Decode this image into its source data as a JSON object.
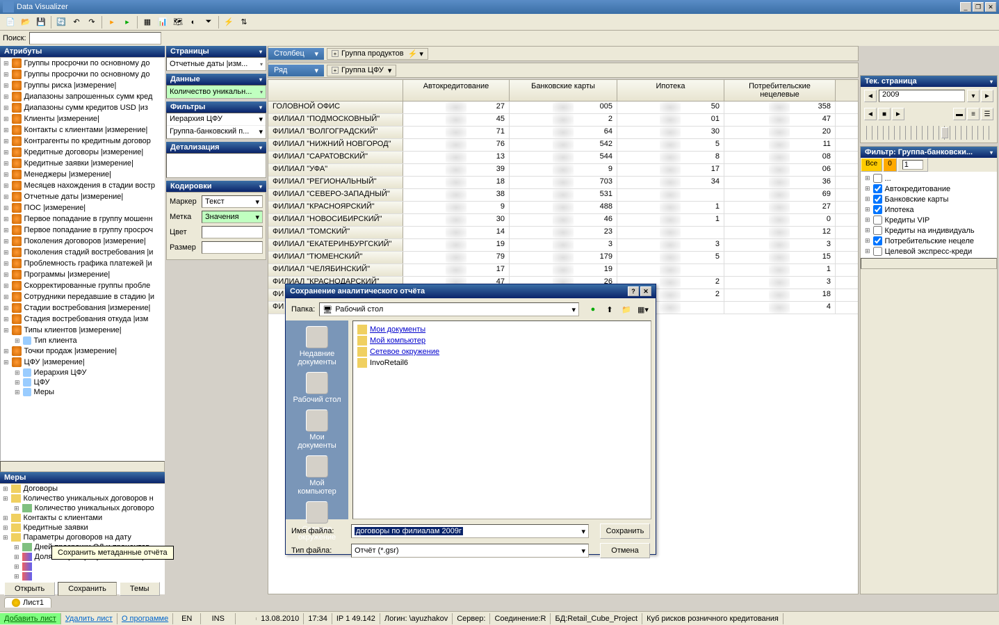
{
  "app": {
    "title": "Data Visualizer"
  },
  "search": {
    "label": "Поиск:",
    "value": ""
  },
  "attributes": {
    "header": "Атрибуты",
    "items": [
      "Группы просрочки по основному до",
      "Группы просрочки по основному до",
      "Группы риска  |измерение|",
      "Диапазоны запрошенных сумм кред",
      "Диапазоны сумм кредитов USD  |из",
      "Клиенты  |измерение|",
      "Контакты с клиентами  |измерение|",
      "Контрагенты по кредитным договор",
      "Кредитные договоры  |измерение|",
      "Кредитные заявки  |измерение|",
      "Менеджеры  |измерение|",
      "Месяцев нахождения в стадии востр",
      "Отчетные даты  |измерение|",
      "ПОС  |измерение|",
      "Первое попадание в группу мошенн",
      "Первое попадание в группу просроч",
      "Поколения договоров  |измерение|",
      "Поколения стадий востребования  |и",
      "Проблемность графика платежей  |и",
      "Программы  |измерение|",
      "Скорректированные группы пробле",
      "Сотрудники передавшие в стадию  |и",
      "Стадии востребования  |измерение|",
      "Стадия востребования откуда  |изм"
    ],
    "expanded1": {
      "label": "Типы клиентов  |измерение|",
      "child": "Тип клиента"
    },
    "item2": "Точки продаж  |измерение|",
    "expanded2": {
      "label": "ЦФУ  |измерение|",
      "children": [
        "Иерархия ЦФУ",
        "ЦФУ",
        "Меры"
      ]
    }
  },
  "measures": {
    "header": "Меры",
    "items": [
      {
        "t": "folder",
        "label": "Договоры"
      },
      {
        "t": "folder-open",
        "label": "Количество уникальных договоров н",
        "child": "Количество уникальных договоро"
      },
      {
        "t": "folder",
        "label": "Контакты с клиентами"
      },
      {
        "t": "folder",
        "label": "Кредитные заявки"
      },
      {
        "t": "folder-open",
        "label": "Параметры договоров на дату",
        "children": [
          {
            "t": "m",
            "label": "Дней просрочки ОД и процентов"
          },
          {
            "t": "p",
            "label": "Доля общей просрочки от общег"
          },
          {
            "t": "p",
            "label": ""
          },
          {
            "t": "p",
            "label": ""
          }
        ]
      }
    ]
  },
  "mid": {
    "pages": {
      "header": "Страницы",
      "value": "Отчетные даты  |изм..."
    },
    "data": {
      "header": "Данные",
      "value": "Количество  уникальн..."
    },
    "filters": {
      "header": "Фильтры",
      "items": [
        "Иерархия ЦФУ",
        "Группа-банковский  п..."
      ]
    },
    "detail": {
      "header": "Детализация",
      "value": ""
    },
    "encoding": {
      "header": "Кодировки",
      "marker_label": "Маркер",
      "marker_value": "Текст",
      "label_label": "Метка",
      "label_value": "Значения",
      "color_label": "Цвет",
      "color_value": "",
      "size_label": "Размер",
      "size_value": ""
    }
  },
  "grid": {
    "col_label": "Столбец",
    "col_value": "Группа продуктов",
    "row_label": "Ряд",
    "row_value": "Группа ЦФУ",
    "cols": [
      "",
      "Автокредитование",
      "Банковские карты",
      "Ипотека",
      "Потребительские нецелевые"
    ],
    "rows": [
      {
        "h": "ГОЛОВНОЙ ОФИС",
        "v": [
          "27",
          "005",
          "50",
          "358"
        ]
      },
      {
        "h": "ФИЛИАЛ \"ПОДМОСКОВНЫЙ\"",
        "v": [
          "45",
          "2",
          "01",
          "47"
        ]
      },
      {
        "h": "ФИЛИАЛ \"ВОЛГОГРАДСКИЙ\"",
        "v": [
          "71",
          "64",
          "30",
          "20"
        ]
      },
      {
        "h": "ФИЛИАЛ \"НИЖНИЙ НОВГОРОД\"",
        "v": [
          "76",
          "542",
          "5",
          "11"
        ]
      },
      {
        "h": "ФИЛИАЛ \"САРАТОВСКИЙ\"",
        "v": [
          "13",
          "544",
          "8",
          "08"
        ]
      },
      {
        "h": "ФИЛИАЛ \"УФА\"",
        "v": [
          "39",
          "9",
          "17",
          "06"
        ]
      },
      {
        "h": "ФИЛИАЛ \"РЕГИОНАЛЬНЫЙ\"",
        "v": [
          "18",
          "703",
          "34",
          "36"
        ]
      },
      {
        "h": "ФИЛИАЛ \"СЕВЕРО-ЗАПАДНЫЙ\"",
        "v": [
          "38",
          "531",
          "",
          "69"
        ]
      },
      {
        "h": "ФИЛИАЛ \"КРАСНОЯРСКИЙ\"",
        "v": [
          "9",
          "488",
          "1",
          "27"
        ]
      },
      {
        "h": "ФИЛИАЛ \"НОВОСИБИРСКИЙ\"",
        "v": [
          "30",
          "46",
          "1",
          "0"
        ]
      },
      {
        "h": "ФИЛИАЛ \"ТОМСКИЙ\"",
        "v": [
          "14",
          "23",
          "",
          "12"
        ]
      },
      {
        "h": "ФИЛИАЛ \"ЕКАТЕРИНБУРГСКИЙ\"",
        "v": [
          "19",
          "3",
          "3",
          "3"
        ]
      },
      {
        "h": "ФИЛИАЛ \"ТЮМЕНСКИЙ\"",
        "v": [
          "79",
          "179",
          "5",
          "15"
        ]
      },
      {
        "h": "ФИЛИАЛ \"ЧЕЛЯБИНСКИЙ\"",
        "v": [
          "17",
          "19",
          "",
          "1"
        ]
      },
      {
        "h": "ФИЛИАЛ \"КРАСНОДАРСКИЙ\"",
        "v": [
          "47",
          "26",
          "2",
          "3"
        ]
      },
      {
        "h": "ФИ",
        "v": [
          "",
          "",
          "2",
          "18"
        ]
      },
      {
        "h": "ФИ",
        "v": [
          "",
          "",
          "",
          "4"
        ]
      }
    ]
  },
  "right": {
    "page": {
      "header": "Тек. страница",
      "year": "2009"
    },
    "filter": {
      "header": "Фильтр:  Группа-банковски...",
      "tab_all": "Все",
      "tab_0": "0",
      "input": "1",
      "items": [
        {
          "checked": false,
          "label": "..."
        },
        {
          "checked": true,
          "label": "Автокредитование"
        },
        {
          "checked": true,
          "label": "Банковские карты"
        },
        {
          "checked": true,
          "label": "Ипотека"
        },
        {
          "checked": false,
          "label": "Кредиты VIP"
        },
        {
          "checked": false,
          "label": "Кредиты на индивидуаль"
        },
        {
          "checked": true,
          "label": "Потребительские нецеле"
        },
        {
          "checked": false,
          "label": "Целевой экспресс-креди"
        }
      ]
    }
  },
  "dialog": {
    "title": "Сохранение аналитического отчёта",
    "folder_label": "Папка:",
    "folder_value": "Рабочий стол",
    "side": [
      "Недавние документы",
      "Рабочий стол",
      "Мои документы",
      "Мой компьютер",
      "Сетевое окружение"
    ],
    "files": [
      {
        "label": "Мои документы",
        "link": true
      },
      {
        "label": "Мой компьютер",
        "link": true
      },
      {
        "label": "Сетевое окружение",
        "link": true
      },
      {
        "label": "InvoRetail6",
        "link": false
      }
    ],
    "fname_label": "Имя файла:",
    "fname_value": "договоры по филиалам 2009г",
    "ftype_label": "Тип файла:",
    "ftype_value": "Отчёт  (*.gsr)",
    "save": "Сохранить",
    "cancel": "Отмена"
  },
  "tooltip": "Сохранить метаданные отчёта",
  "bottom": {
    "open": "Открыть",
    "save": "Сохранить",
    "themes": "Темы",
    "sheet": "Лист1"
  },
  "status": {
    "add_sheet": "Добавить лист",
    "del_sheet": "Удалить лист",
    "about": "О программе",
    "lang": "EN",
    "ins": "INS",
    "date": "13.08.2010",
    "time": "17:34",
    "ip": "IP 1         49.142",
    "login": "Логин:        \\ayuzhakov",
    "server": "Сервер:",
    "conn": "Соединение:R",
    "db": "БД:Retail_Cube_Project",
    "cube": "Куб рисков розничного кредитования"
  }
}
